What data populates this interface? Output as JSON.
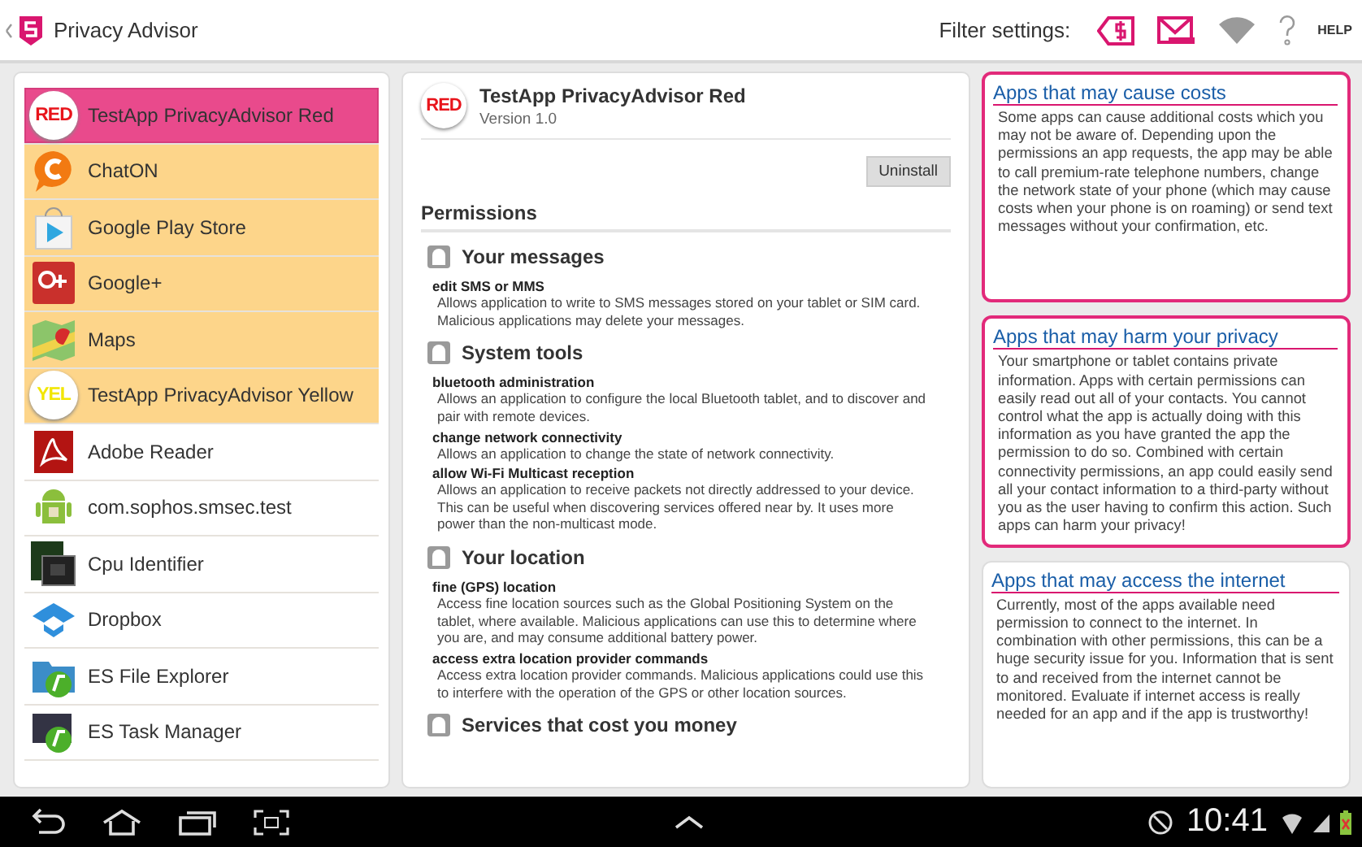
{
  "app_bar": {
    "title": "Privacy Advisor",
    "filter_label": "Filter settings:",
    "filters": [
      {
        "on": true
      },
      {
        "on": true
      },
      {
        "on": false
      },
      {
        "on": false
      }
    ],
    "help": "HELP"
  },
  "apps": [
    {
      "name": "TestApp PrivacyAdvisor Red",
      "badge": "RED",
      "color": "#e94a8c",
      "selected": true
    },
    {
      "name": "ChatON",
      "color": "#fdd58a",
      "selected": false
    },
    {
      "name": "Google Play Store",
      "color": "#fdd58a",
      "selected": false
    },
    {
      "name": "Google+",
      "color": "#fdd58a",
      "selected": false
    },
    {
      "name": "Maps",
      "color": "#fdd58a",
      "selected": false
    },
    {
      "name": "TestApp PrivacyAdvisor Yellow",
      "badge": "YEL",
      "color": "#fdd58a",
      "selected": false
    },
    {
      "name": "Adobe Reader",
      "color": "#ffffff",
      "selected": false
    },
    {
      "name": "com.sophos.smsec.test",
      "color": "#ffffff",
      "selected": false
    },
    {
      "name": "Cpu Identifier",
      "color": "#ffffff",
      "selected": false
    },
    {
      "name": "Dropbox",
      "color": "#ffffff",
      "selected": false
    },
    {
      "name": "ES File Explorer",
      "color": "#ffffff",
      "selected": false
    },
    {
      "name": "ES Task Manager",
      "color": "#ffffff",
      "selected": false
    }
  ],
  "detail": {
    "badge": "RED",
    "name": "TestApp PrivacyAdvisor Red",
    "version": "Version 1.0",
    "uninstall": "Uninstall",
    "permissions_heading": "Permissions",
    "groups": [
      {
        "title": "Your messages",
        "items": [
          {
            "name": "edit SMS or MMS",
            "desc": "Allows application to write to SMS messages stored on your tablet or SIM card. Malicious applications may delete your messages."
          }
        ]
      },
      {
        "title": "System tools",
        "items": [
          {
            "name": "bluetooth administration",
            "desc": "Allows an application to configure the local Bluetooth tablet, and to discover and pair with remote devices."
          },
          {
            "name": "change network connectivity",
            "desc": "Allows an application to change the state of network connectivity."
          },
          {
            "name": "allow Wi-Fi Multicast reception",
            "desc": "Allows an application to receive packets not directly addressed to your device. This can be useful when discovering services offered near by. It uses more power than the non-multicast mode."
          }
        ]
      },
      {
        "title": "Your location",
        "items": [
          {
            "name": "fine (GPS) location",
            "desc": "Access fine location sources such as the Global Positioning System on the tablet, where available. Malicious applications can use this to determine where you are, and may consume additional battery power."
          },
          {
            "name": "access extra location provider commands",
            "desc": "Access extra location provider commands. Malicious applications could use this to interfere with the operation of the GPS or other location sources."
          }
        ]
      },
      {
        "title": "Services that cost you money"
      }
    ]
  },
  "info_cards": [
    {
      "title": "Apps that may cause costs",
      "highlighted": true,
      "text": "Some apps can cause additional costs which you may not be aware of. Depending upon the permissions an app requests, the app may be able to call premium-rate telephone numbers, change the network state of your phone (which may cause costs when your phone is on roaming) or send text messages without your confirmation, etc."
    },
    {
      "title": "Apps that may harm your privacy",
      "highlighted": true,
      "text": "Your smartphone or tablet contains private information. Apps with certain permissions can easily read out all of your contacts. You cannot control what the app is actually doing with this information as you have granted the app the permission to do so. Combined with certain connectivity permissions, an app could easily send all your contact information to a third-party without you as the user having to confirm this action. Such apps can harm your privacy!"
    },
    {
      "title": "Apps that may access the internet",
      "highlighted": false,
      "text": "Currently, most of the apps available need permission to connect to the internet. In combination with other permissions, this can be a huge security issue for you. Information that is sent to and received from the internet cannot be monitored. Evaluate if internet access is really needed for an app and if the app is trustworthy!"
    }
  ],
  "system_bar": {
    "time": "10:41"
  }
}
